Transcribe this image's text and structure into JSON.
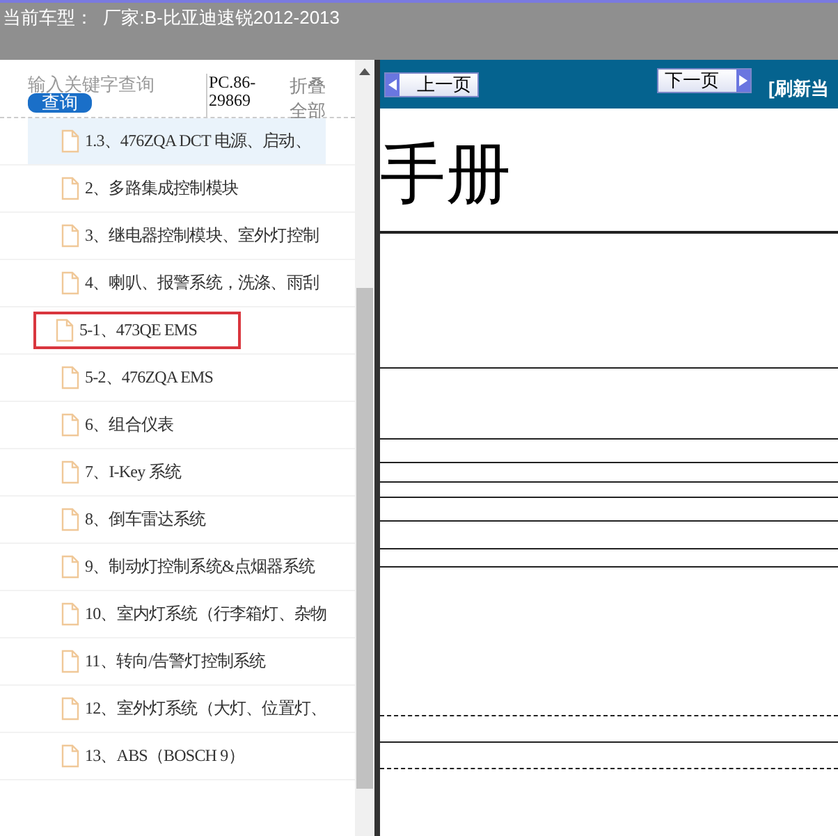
{
  "header": {
    "title": "当前车型：  厂家:B-比亚迪速锐2012-2013"
  },
  "search": {
    "placeholder": "输入关键字查询",
    "button": "查询",
    "code": "PC.86-29869",
    "collapse": "折叠全部"
  },
  "tree": [
    {
      "label": "1.3、476ZQA DCT 电源、启动、",
      "selected": true,
      "highlighted": false
    },
    {
      "label": "2、多路集成控制模块",
      "selected": false,
      "highlighted": false
    },
    {
      "label": "3、继电器控制模块、室外灯控制",
      "selected": false,
      "highlighted": false
    },
    {
      "label": "4、喇叭、报警系统，洗涤、雨刮",
      "selected": false,
      "highlighted": false
    },
    {
      "label": "5-1、473QE EMS",
      "selected": false,
      "highlighted": true
    },
    {
      "label": "5-2、476ZQA EMS",
      "selected": false,
      "highlighted": false
    },
    {
      "label": "6、组合仪表",
      "selected": false,
      "highlighted": false
    },
    {
      "label": "7、I-Key 系统",
      "selected": false,
      "highlighted": false
    },
    {
      "label": "8、倒车雷达系统",
      "selected": false,
      "highlighted": false
    },
    {
      "label": "9、制动灯控制系统&点烟器系统",
      "selected": false,
      "highlighted": false
    },
    {
      "label": "10、室内灯系统（行李箱灯、杂物",
      "selected": false,
      "highlighted": false
    },
    {
      "label": "11、转向/告警灯控制系统",
      "selected": false,
      "highlighted": false
    },
    {
      "label": "12、室外灯系统（大灯、位置灯、",
      "selected": false,
      "highlighted": false
    },
    {
      "label": "13、ABS（BOSCH 9）",
      "selected": false,
      "highlighted": false
    }
  ],
  "toolbar": {
    "prev": "上一页",
    "next": "下一页",
    "refresh": "[刷新当"
  },
  "document": {
    "title": "手册"
  }
}
